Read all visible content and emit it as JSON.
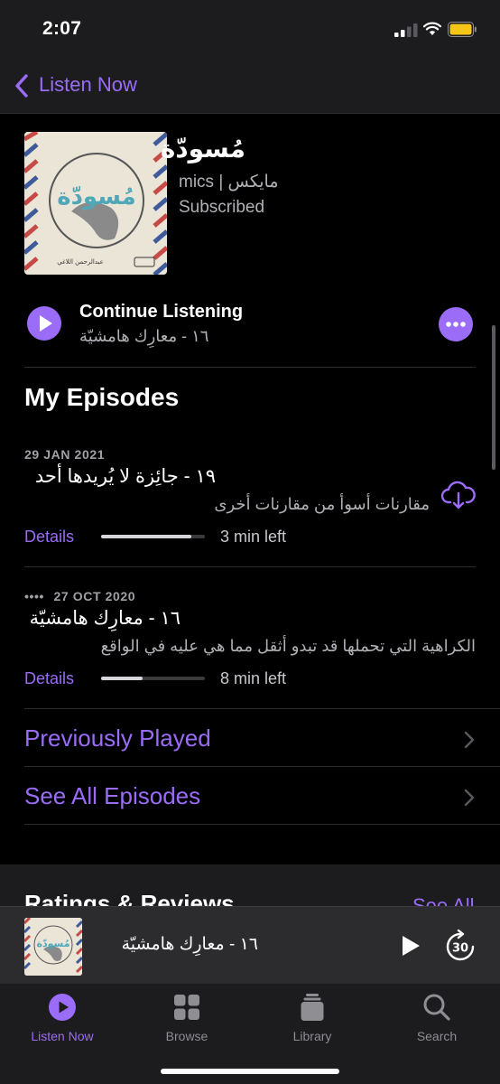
{
  "status_bar": {
    "time": "2:07"
  },
  "nav": {
    "back_label": "Listen Now"
  },
  "podcast": {
    "title": "مُسودّة",
    "author": "mics | مايكس",
    "status": "Subscribed",
    "artwork_text": "مُسودّة",
    "artwork_author": "عبدالرحمن اللاغي"
  },
  "continue": {
    "label": "Continue Listening",
    "episode": "١٦ - معارِك هامشيّة"
  },
  "my_episodes": {
    "title": "My Episodes",
    "episodes": [
      {
        "date": "29 JAN 2021",
        "title": "١٩ - جائِزة لا يُريدها أحد",
        "description": "مقارنات أسوأ من مقارنات أخرى",
        "details": "Details",
        "progress": 0.87,
        "time_left": "3 min left"
      },
      {
        "date": "27 OCT 2020",
        "date_prefix": "••••",
        "title": "١٦ - معارِك هامشيّة",
        "description": "الكراهية التي تحملها قد تبدو أثقل مما هي عليه في الواقع",
        "details": "Details",
        "progress": 0.4,
        "time_left": "8 min left"
      }
    ]
  },
  "links": {
    "previously_played": "Previously Played",
    "see_all": "See All Episodes"
  },
  "ratings": {
    "title": "Ratings & Reviews",
    "see_all": "See All"
  },
  "mini_player": {
    "title": "١٦ - معارِك هامشيّة",
    "skip_seconds": "30"
  },
  "tabs": [
    {
      "label": "Listen Now",
      "icon": "listen-now-icon",
      "active": true
    },
    {
      "label": "Browse",
      "icon": "browse-icon",
      "active": false
    },
    {
      "label": "Library",
      "icon": "library-icon",
      "active": false
    },
    {
      "label": "Search",
      "icon": "search-icon",
      "active": false
    }
  ],
  "colors": {
    "accent": "#9b6cf7",
    "background": "#000000",
    "surface": "#1c1c1e"
  }
}
